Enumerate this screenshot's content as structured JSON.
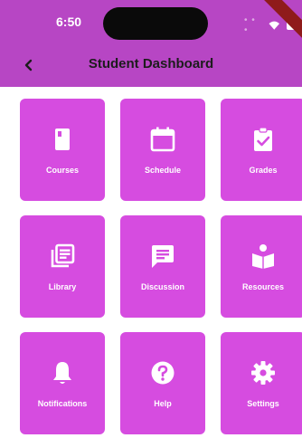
{
  "status_bar": {
    "time": "6:50"
  },
  "header": {
    "title": "Student Dashboard"
  },
  "tiles": [
    {
      "label": "Courses",
      "icon": "book-icon"
    },
    {
      "label": "Schedule",
      "icon": "calendar-icon"
    },
    {
      "label": "Grades",
      "icon": "clipboard-check-icon"
    },
    {
      "label": "Library",
      "icon": "library-icon"
    },
    {
      "label": "Discussion",
      "icon": "chat-icon"
    },
    {
      "label": "Resources",
      "icon": "reading-icon"
    },
    {
      "label": "Notifications",
      "icon": "bell-icon"
    },
    {
      "label": "Help",
      "icon": "help-icon"
    },
    {
      "label": "Settings",
      "icon": "gear-icon"
    }
  ],
  "colors": {
    "appbar": "#b746c4",
    "tile": "#d64ce0",
    "text": "#ffffff"
  }
}
